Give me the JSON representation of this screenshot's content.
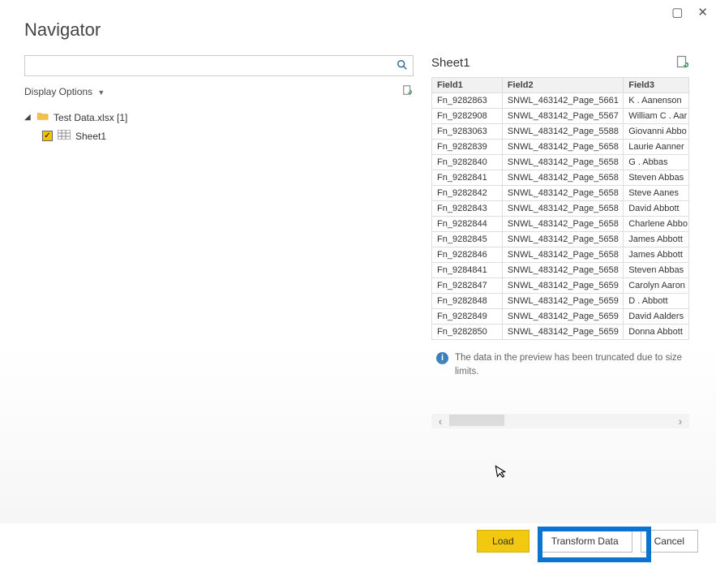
{
  "window": {
    "title": "Navigator"
  },
  "left": {
    "display_label": "Display Options",
    "file_label": "Test Data.xlsx [1]",
    "sheet_label": "Sheet1"
  },
  "preview": {
    "title": "Sheet1",
    "columns": [
      "Field1",
      "Field2",
      "Field3"
    ],
    "rows": [
      [
        "Fn_9282863",
        "SNWL_463142_Page_5661",
        "K . Aanenson"
      ],
      [
        "Fn_9282908",
        "SNWL_483142_Page_5567",
        "William C . Aar"
      ],
      [
        "Fn_9283063",
        "SNWL_483142_Page_5588",
        "Giovanni Abbo"
      ],
      [
        "Fn_9282839",
        "SNWL_483142_Page_5658",
        "Laurie Aanner"
      ],
      [
        "Fn_9282840",
        "SNWL_483142_Page_5658",
        "G . Abbas"
      ],
      [
        "Fn_9282841",
        "SNWL_483142_Page_5658",
        "Steven Abbas"
      ],
      [
        "Fn_9282842",
        "SNWL_483142_Page_5658",
        "Steve Aanes"
      ],
      [
        "Fn_9282843",
        "SNWL_483142_Page_5658",
        "David Abbott"
      ],
      [
        "Fn_9282844",
        "SNWL_483142_Page_5658",
        "Charlene Abbo"
      ],
      [
        "Fn_9282845",
        "SNWL_483142_Page_5658",
        "James Abbott"
      ],
      [
        "Fn_9282846",
        "SNWL_483142_Page_5658",
        "James Abbott"
      ],
      [
        "Fn_9284841",
        "SNWL_483142_Page_5658",
        "Steven Abbas"
      ],
      [
        "Fn_9282847",
        "SNWL_483142_Page_5659",
        "Carolyn Aaron"
      ],
      [
        "Fn_9282848",
        "SNWL_483142_Page_5659",
        "D . Abbott"
      ],
      [
        "Fn_9282849",
        "SNWL_483142_Page_5659",
        "David Aalders"
      ],
      [
        "Fn_9282850",
        "SNWL_483142_Page_5659",
        "Donna Abbott"
      ]
    ],
    "truncated_msg": "The data in the preview has been truncated due to size limits."
  },
  "buttons": {
    "load": "Load",
    "transform": "Transform Data",
    "cancel": "Cancel"
  }
}
